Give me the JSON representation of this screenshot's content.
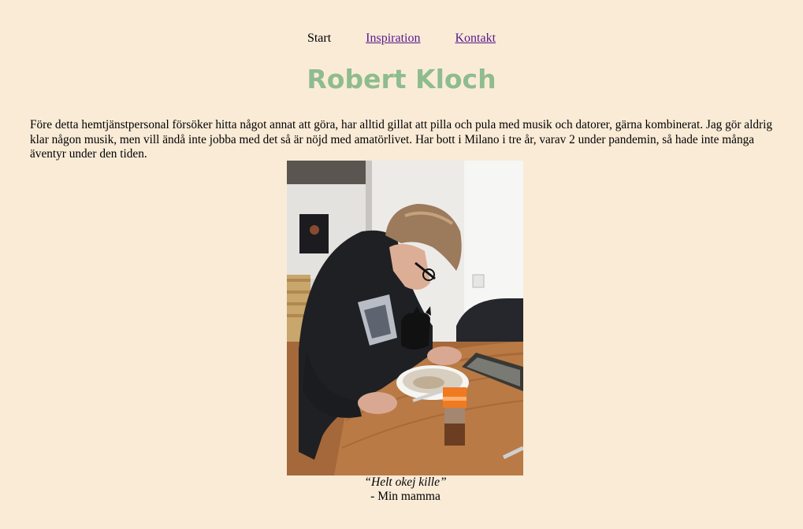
{
  "nav": {
    "items": [
      {
        "label": "Start",
        "current": true
      },
      {
        "label": "Inspiration",
        "current": false
      },
      {
        "label": "Kontakt",
        "current": false
      }
    ]
  },
  "page": {
    "title": "Robert Kloch",
    "intro": "Före detta hemtjänstpersonal försöker hitta något annat att göra, har alltid gillat att pilla och pula med musik och datorer, gärna kombinerat. Jag gör aldrig klar någon musik, men vill ändå inte jobba med det så är nöjd med amatörlivet. Har bott i Milano i tre år, varav 2 under pandemin, så hade inte många äventyr under den tiden."
  },
  "quote": {
    "text": "“Helt okej kille”",
    "author": "- Min mamma"
  },
  "colors": {
    "background": "#faebd7",
    "title": "#8fbc8f",
    "link": "#551a8b"
  }
}
